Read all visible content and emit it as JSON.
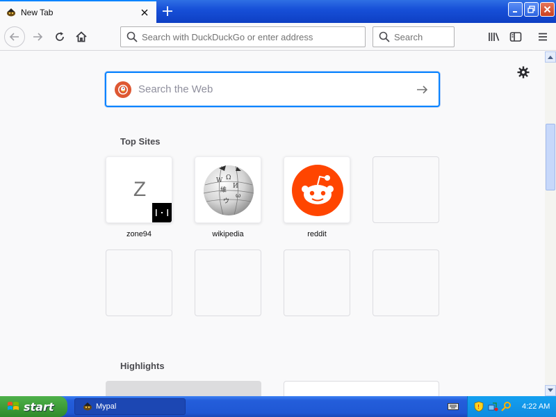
{
  "browser": {
    "tab": {
      "title": "New Tab"
    },
    "urlbar": {
      "placeholder": "Search with DuckDuckGo or enter address"
    },
    "searchbar": {
      "placeholder": "Search"
    }
  },
  "newtab": {
    "web_search": {
      "placeholder": "Search the Web"
    },
    "top_sites_heading": "Top Sites",
    "top_sites": [
      {
        "label": "zone94",
        "letter": "Z"
      },
      {
        "label": "wikipedia"
      },
      {
        "label": "reddit"
      },
      {
        "label": ""
      },
      {
        "label": ""
      },
      {
        "label": ""
      },
      {
        "label": ""
      },
      {
        "label": ""
      }
    ],
    "highlights_heading": "Highlights"
  },
  "taskbar": {
    "start_label": "start",
    "task_item": "Mypal",
    "clock": "4:22 AM"
  },
  "colors": {
    "accent": "#0a84ff",
    "reddit": "#ff4500",
    "duckduckgo": "#de5833",
    "xp_blue": "#245edb",
    "xp_green": "#3b9a36"
  }
}
